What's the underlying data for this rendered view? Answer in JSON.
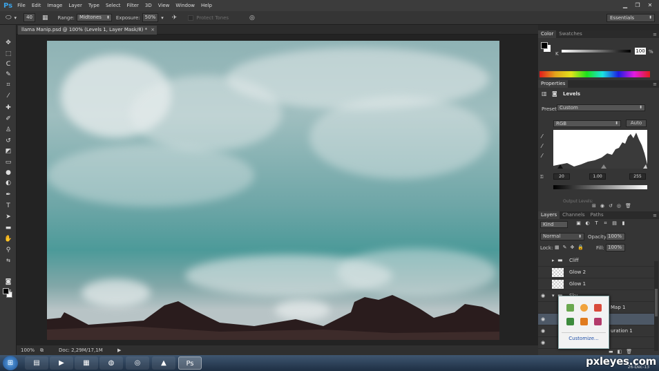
{
  "app": {
    "logo": "Ps"
  },
  "menu": [
    "File",
    "Edit",
    "Image",
    "Layer",
    "Type",
    "Select",
    "Filter",
    "3D",
    "View",
    "Window",
    "Help"
  ],
  "options": {
    "brush_size": "40",
    "range_label": "Range:",
    "range_value": "Midtones",
    "exposure_label": "Exposure:",
    "exposure_value": "50%",
    "protect_tones": "Protect Tones",
    "workspace": "Essentials"
  },
  "document": {
    "tab_title": "llama Manip.psd @ 100% (Levels 1, Layer Mask/8) *",
    "close": "×"
  },
  "status": {
    "zoom": "100%",
    "doc_size": "Doc: 2,29M/17,1M",
    "arrow": "▶"
  },
  "color_panel": {
    "tabs": [
      "Color",
      "Swatches"
    ],
    "channel": "K",
    "value": "100",
    "unit": "%"
  },
  "properties": {
    "tab": "Properties",
    "title": "Levels",
    "preset_label": "Preset:",
    "preset_value": "Custom",
    "channel": "RGB",
    "auto": "Auto",
    "input_black": "20",
    "input_gamma": "1.00",
    "input_white": "255",
    "output_label": "Output Levels:"
  },
  "layers_panel": {
    "tabs": [
      "Layers",
      "Channels",
      "Paths"
    ],
    "kind": "Kind",
    "blend_mode": "Normal",
    "opacity_label": "Opacity:",
    "opacity_value": "100%",
    "lock_label": "Lock:",
    "fill_label": "Fill:",
    "fill_value": "100%",
    "layers": [
      {
        "name": "Cliff",
        "type": "group",
        "visible": false
      },
      {
        "name": "Glow 2",
        "type": "layer",
        "visible": false
      },
      {
        "name": "Glow 1",
        "type": "layer",
        "visible": false
      },
      {
        "name": "Sky",
        "type": "group",
        "visible": true
      },
      {
        "name": "Map 1",
        "type": "adjustment",
        "visible": false
      },
      {
        "name": "",
        "type": "adjustment",
        "visible": true
      },
      {
        "name": "uration 1",
        "type": "adjustment",
        "visible": true
      },
      {
        "name": "",
        "type": "layer",
        "visible": true
      }
    ]
  },
  "popup": {
    "customize": "Customize..."
  },
  "taskbar": {
    "watermark": "pxleyes.com",
    "clock": "26-Dec-13"
  }
}
